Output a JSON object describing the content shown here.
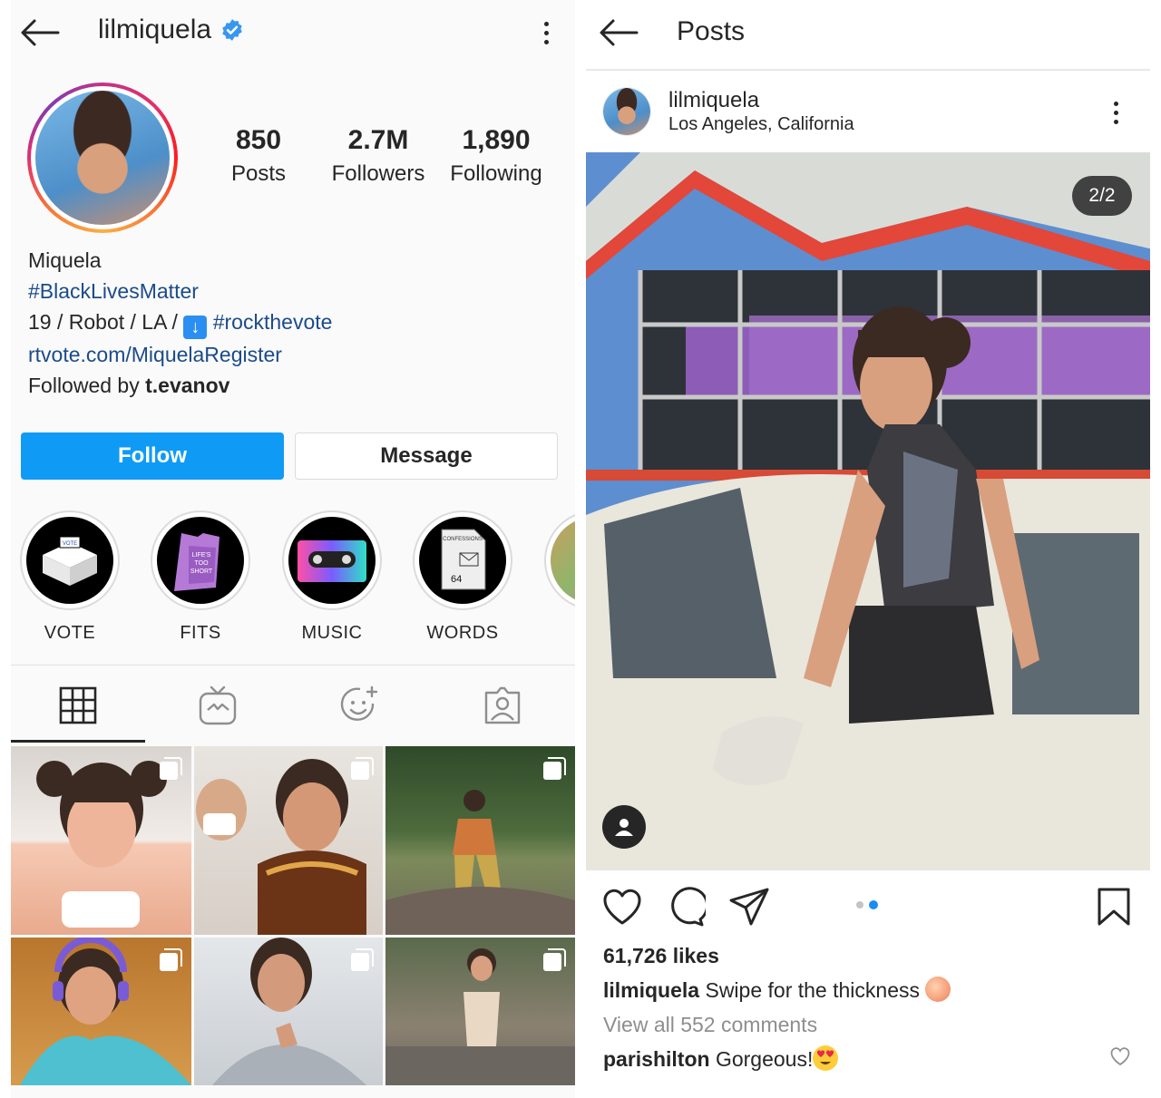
{
  "profile": {
    "username": "lilmiquela",
    "stats": [
      {
        "value": "850",
        "label": "Posts"
      },
      {
        "value": "2.7M",
        "label": "Followers"
      },
      {
        "value": "1,890",
        "label": "Following"
      }
    ],
    "bio": {
      "name": "Miquela",
      "hashtag": "#BlackLivesMatter",
      "line3_text": "19 / Robot / LA / ",
      "line3_tag": "#rockthevote",
      "link": "rtvote.com/MiquelaRegister",
      "followed_by_prefix": "Followed by ",
      "followed_by_user": "t.evanov"
    },
    "follow_label": "Follow",
    "message_label": "Message",
    "highlights": [
      {
        "label": "VOTE"
      },
      {
        "label": "FITS"
      },
      {
        "label": "MUSIC"
      },
      {
        "label": "WORDS"
      },
      {
        "label": "#"
      }
    ],
    "tabs": [
      "grid-icon",
      "igtv-icon",
      "reels-icon",
      "tagged-icon"
    ],
    "accent": "#0f9bf5"
  },
  "post": {
    "header_title": "Posts",
    "username": "lilmiquela",
    "location": "Los Angeles, California",
    "counter": "2/2",
    "likes": "61,726 likes",
    "caption_user": "lilmiquela",
    "caption_text": " Swipe for the thickness ",
    "view_comments": "View all 552 comments",
    "comment_user": "parishilton",
    "comment_text": " Gorgeous!",
    "carousel": {
      "total": 2,
      "active": 2
    }
  }
}
